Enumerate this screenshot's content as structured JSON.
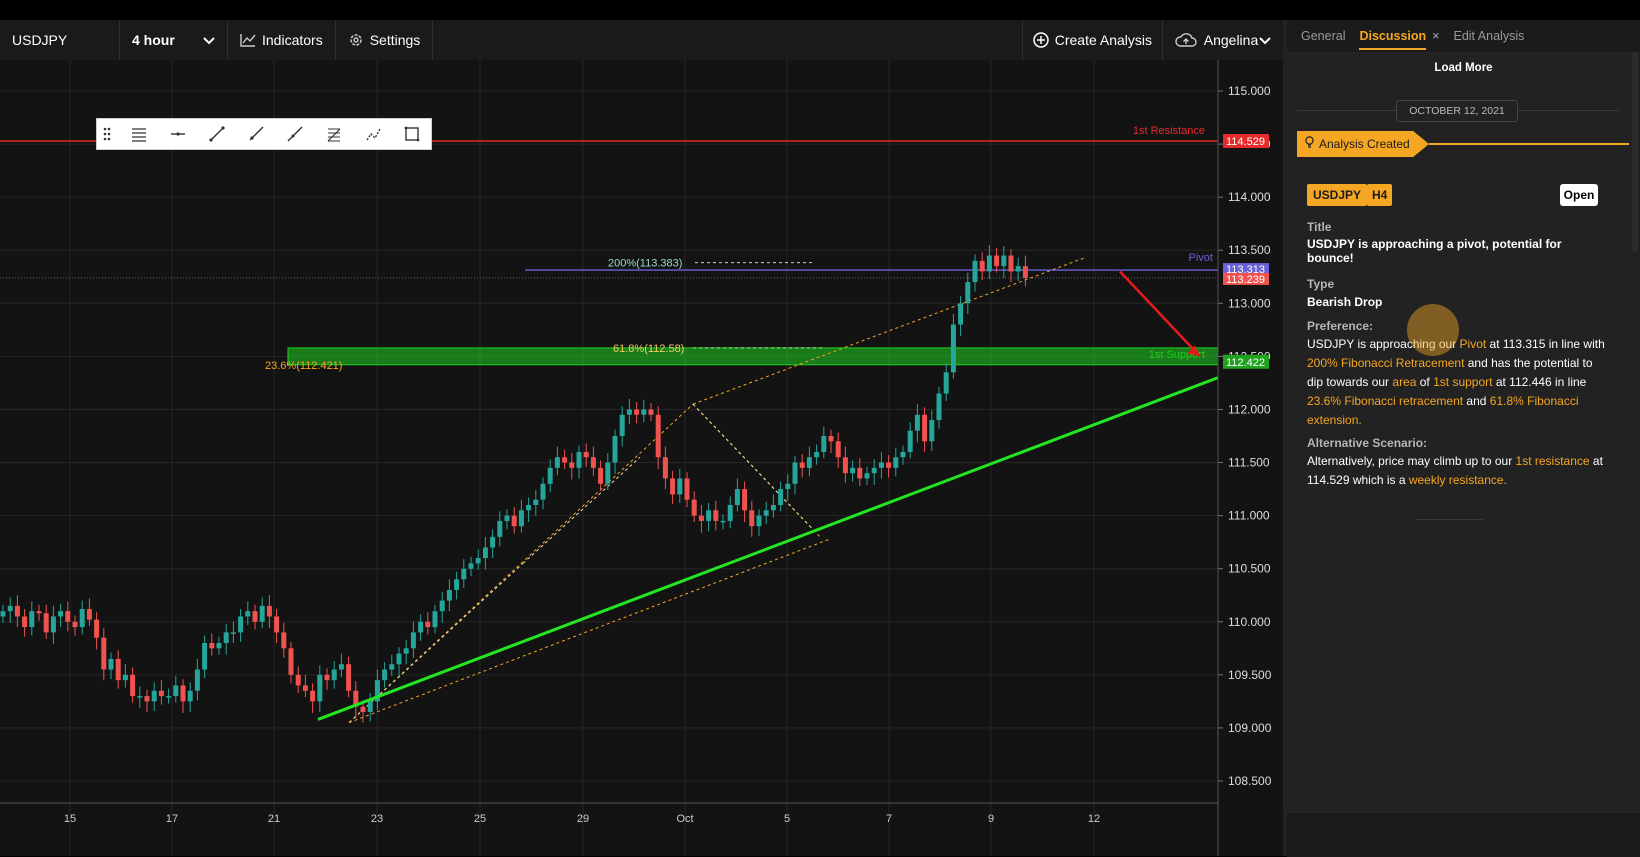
{
  "toolbar": {
    "symbol": "USDJPY",
    "timeframe": "4 hour",
    "indicators": "Indicators",
    "settings": "Settings",
    "create_analysis": "Create Analysis",
    "user": "Angelina"
  },
  "chart": {
    "price_ticks": [
      "115.000",
      "114.500",
      "114.000",
      "113.500",
      "113.000",
      "112.500",
      "112.000",
      "111.500",
      "111.000",
      "110.500",
      "110.000",
      "109.500",
      "109.000",
      "108.500"
    ],
    "date_ticks": [
      "15",
      "17",
      "21",
      "23",
      "25",
      "29",
      "Oct",
      "5",
      "7",
      "9",
      "12"
    ],
    "annotations": {
      "resistance_label": "1st Resistance",
      "resistance_price": "114.529",
      "pivot_label": "Pivot",
      "pivot_price": "113.313",
      "current_price": "113.239",
      "support_label": "1st Support",
      "support_price": "112.422",
      "fib_200": "200%(113.383)",
      "fib_618": "61.8%(112.58)",
      "fib_236": "23.6%(112.421)"
    },
    "colors": {
      "bull": "#26a69a",
      "bear": "#ef5350",
      "resistance": "#e52b2b",
      "support_zone": "#1fd11f",
      "pivot": "#6b62d8",
      "trendline": "#22e622",
      "fib": "#f5a623"
    },
    "candle_icons": [
      "drag-icon",
      "horizontal-lines-icon",
      "horizontal-line-icon",
      "trend-line-icon",
      "ray-icon",
      "extended-line-icon",
      "fibonacci-icon",
      "pattern-icon",
      "rectangle-icon"
    ]
  },
  "panel": {
    "tabs": [
      "General",
      "Discussion",
      "Edit Analysis"
    ],
    "tab_close": "×",
    "load_more": "Load More",
    "date": "OCTOBER 12, 2021",
    "event": "Analysis Created",
    "badges": [
      "USDJPY",
      "H4"
    ],
    "open_button": "Open",
    "title_label": "Title",
    "title": "USDJPY is approaching a pivot, potential for bounce!",
    "type_label": "Type",
    "type": "Bearish Drop",
    "preference_label": "Preference:",
    "preference": [
      [
        "USDJPY is approaching our ",
        false
      ],
      [
        "Pivot",
        true
      ],
      [
        " at 113.315 in line with ",
        false
      ],
      [
        "200% Fibonacci Retracement",
        true
      ],
      [
        " and has the potential to dip towards our ",
        false
      ],
      [
        "area",
        true
      ],
      [
        " of ",
        false
      ],
      [
        "1st support",
        true
      ],
      [
        " at 112.446 in line ",
        false
      ],
      [
        "23.6% Fibonacci retracement",
        true
      ],
      [
        " and ",
        false
      ],
      [
        "61.8% Fibonacci extension.",
        true
      ]
    ],
    "alternative_label": "Alternative Scenario:",
    "alternative": [
      [
        "Alternatively, price may climb up to our ",
        false
      ],
      [
        "1st resistance",
        true
      ],
      [
        " at 114.529 which is a ",
        false
      ],
      [
        "weekly resistance.",
        true
      ]
    ]
  }
}
